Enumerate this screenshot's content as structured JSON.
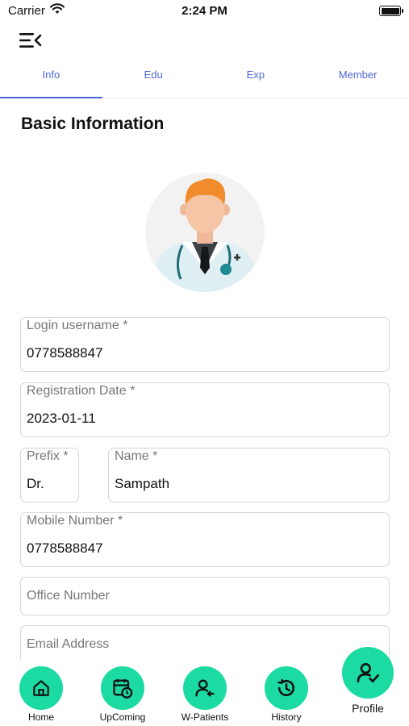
{
  "status_bar": {
    "carrier": "Carrier",
    "time": "2:24 PM"
  },
  "tabs": [
    {
      "label": "Info",
      "active": true
    },
    {
      "label": "Edu",
      "active": false
    },
    {
      "label": "Exp",
      "active": false
    },
    {
      "label": "Member",
      "active": false
    }
  ],
  "section_title": "Basic Information",
  "form": {
    "login_username": {
      "label": "Login username *",
      "value": "0778588847"
    },
    "registration_date": {
      "label": "Registration Date *",
      "value": "2023-01-11"
    },
    "prefix": {
      "label": "Prefix *",
      "value": "Dr."
    },
    "name": {
      "label": "Name *",
      "value": "Sampath"
    },
    "mobile_number": {
      "label": "Mobile Number *",
      "value": "0778588847"
    },
    "office_number": {
      "placeholder": "Office Number"
    },
    "email_address": {
      "placeholder": "Email Address"
    }
  },
  "bottom_nav": [
    {
      "label": "Home",
      "icon": "home-icon"
    },
    {
      "label": "UpComing",
      "icon": "calendar-clock-icon"
    },
    {
      "label": "W-Patients",
      "icon": "user-arrow-icon"
    },
    {
      "label": "History",
      "icon": "history-icon"
    },
    {
      "label": "Profile",
      "icon": "user-check-icon",
      "active": true
    }
  ],
  "colors": {
    "accent": "#1bdba2",
    "tab_text": "#4f68d8",
    "tab_indicator": "#4a66d9"
  }
}
